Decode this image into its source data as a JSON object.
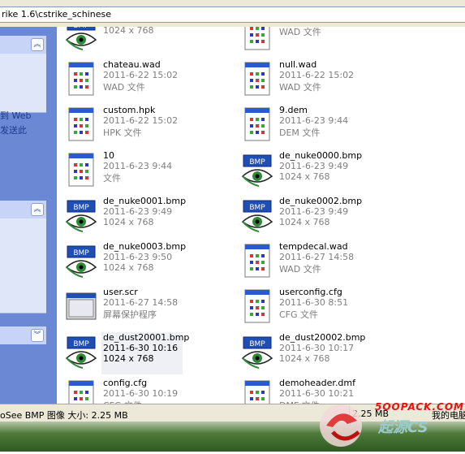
{
  "address": {
    "path": "rike 1.6\\cstrike_schinese"
  },
  "sidebar": {
    "lines": [
      "到 Web",
      "发送此"
    ],
    "chevrons": [
      "chevron-up-icon",
      "chevron-up-icon",
      "chevron-down-icon"
    ]
  },
  "files": [
    {
      "name": "",
      "line2": "1024 x 768",
      "line3": "",
      "icon": "bmp"
    },
    {
      "name": "",
      "line2": "WAD 文件",
      "line3": "",
      "icon": "doc"
    },
    {
      "name": "chateau.wad",
      "line2": "2011-6-22 15:02",
      "line3": "WAD 文件",
      "icon": "doc"
    },
    {
      "name": "null.wad",
      "line2": "2011-6-22 15:02",
      "line3": "WAD 文件",
      "icon": "doc"
    },
    {
      "name": "custom.hpk",
      "line2": "2011-6-22 15:02",
      "line3": "HPK 文件",
      "icon": "doc"
    },
    {
      "name": "9.dem",
      "line2": "2011-6-23 9:44",
      "line3": "DEM 文件",
      "icon": "doc"
    },
    {
      "name": "10",
      "line2": "2011-6-23 9:44",
      "line3": "文件",
      "icon": "doc"
    },
    {
      "name": "de_nuke0000.bmp",
      "line2": "2011-6-23 9:49",
      "line3": "1024 x 768",
      "icon": "bmp"
    },
    {
      "name": "de_nuke0001.bmp",
      "line2": "2011-6-23 9:49",
      "line3": "1024 x 768",
      "icon": "bmp"
    },
    {
      "name": "de_nuke0002.bmp",
      "line2": "2011-6-23 9:49",
      "line3": "1024 x 768",
      "icon": "bmp"
    },
    {
      "name": "de_nuke0003.bmp",
      "line2": "2011-6-23 9:50",
      "line3": "1024 x 768",
      "icon": "bmp"
    },
    {
      "name": "tempdecal.wad",
      "line2": "2011-6-27 14:58",
      "line3": "WAD 文件",
      "icon": "doc"
    },
    {
      "name": "user.scr",
      "line2": "2011-6-27 14:58",
      "line3": "屏幕保护程序",
      "icon": "scr"
    },
    {
      "name": "userconfig.cfg",
      "line2": "2011-6-30 8:51",
      "line3": "CFG 文件",
      "icon": "doc"
    },
    {
      "name": "de_dust20001.bmp",
      "line2": "2011-6-30 10:16",
      "line3": "1024 x 768",
      "icon": "bmp",
      "selected": true
    },
    {
      "name": "de_dust20002.bmp",
      "line2": "2011-6-30 10:17",
      "line3": "1024 x 768",
      "icon": "bmp"
    },
    {
      "name": "config.cfg",
      "line2": "2011-6-30 10:19",
      "line3": "CFG 文件",
      "icon": "doc"
    },
    {
      "name": "demoheader.dmf",
      "line2": "2011-6-30 10:21",
      "line3": "DMF 文件",
      "icon": "doc"
    }
  ],
  "status": {
    "text": "oSee BMP 图像 大小: 2.25 MB",
    "size": "2.25 MB",
    "computer": "我的电脑"
  },
  "watermark": {
    "line1": "5OOPACK.COM",
    "line2": "起源CS"
  },
  "colors": {
    "pane": "#6b88d4",
    "selection": "#eef0f5",
    "bmp_badge": "#1f4fb5"
  }
}
